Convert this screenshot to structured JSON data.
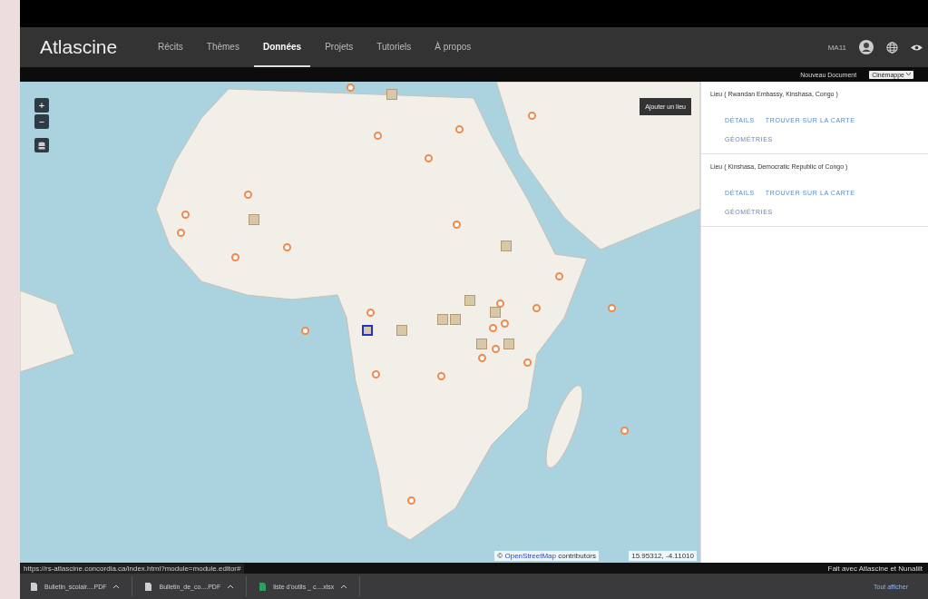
{
  "brand": "Atlascine",
  "nav": [
    {
      "label": "Récits",
      "selected": false
    },
    {
      "label": "Thèmes",
      "selected": false
    },
    {
      "label": "Données",
      "selected": true
    },
    {
      "label": "Projets",
      "selected": false
    },
    {
      "label": "Tutoriels",
      "selected": false
    },
    {
      "label": "À propos",
      "selected": false
    }
  ],
  "user": "MA11",
  "subbar": {
    "new_document": "Nouveau Document",
    "atlas_select": "Cinémappe"
  },
  "map": {
    "add_place": "Ajouter un lieu",
    "zoom_in": "+",
    "zoom_out": "−",
    "attribution_mark": "©",
    "attribution_link": "OpenStreetMap",
    "attribution_text": "contributors",
    "coordinates": "15.95312, -4.11010"
  },
  "places": [
    {
      "title": "Lieu ( Rwandan Embassy, Kinshasa, Congo )",
      "actions": [
        "DÉTAILS",
        "TROUVER SUR LA CARTE",
        "GÉOMÉTRIES"
      ]
    },
    {
      "title": "Lieu ( Kinshasa, Democratic Republic of Congo )",
      "actions": [
        "DÉTAILS",
        "TROUVER SUR LA CARTE",
        "GÉOMÉTRIES"
      ]
    }
  ],
  "status_url": "https://rs-atlascine.concordia.ca/index.html?module=module.editor#",
  "footer_credit": "Fait avec Atlascine et Nunaliit",
  "downloads": [
    {
      "name": "Bulletin_scolair....PDF",
      "kind": "pdf"
    },
    {
      "name": "Bulletin_de_co....PDF",
      "kind": "pdf"
    },
    {
      "name": "liste d'outils _ c....xlsx",
      "kind": "sheet"
    }
  ],
  "show_all": "Tout afficher"
}
